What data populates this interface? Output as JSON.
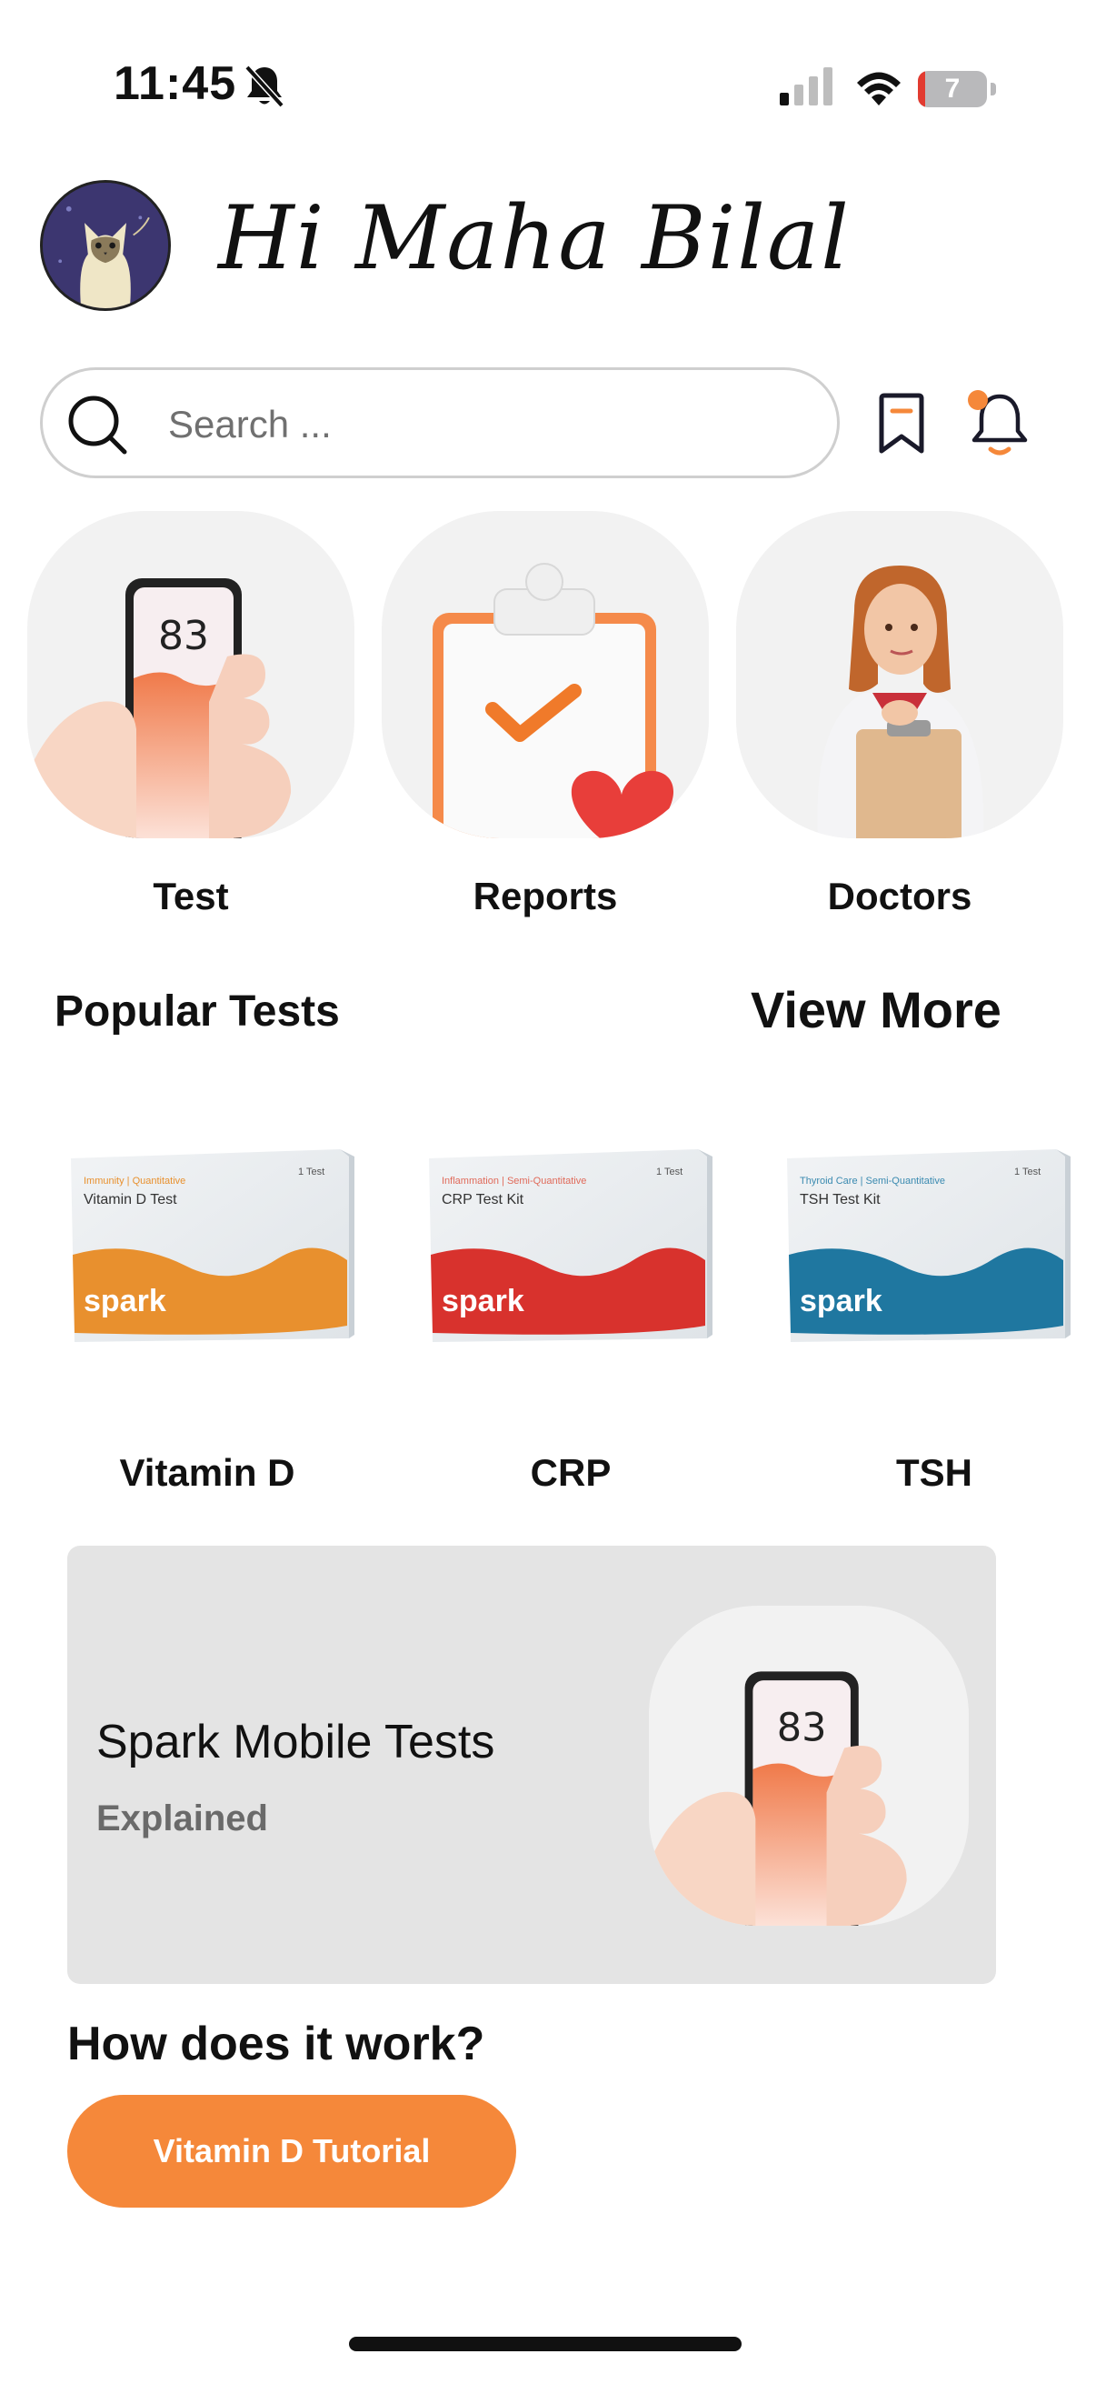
{
  "status_bar": {
    "time": "11:45",
    "battery_level": "7"
  },
  "header": {
    "greeting": "Hi  Maha Bilal"
  },
  "search": {
    "placeholder": "Search ..."
  },
  "categories": [
    {
      "label": "Test",
      "phone_reading": "83"
    },
    {
      "label": "Reports"
    },
    {
      "label": "Doctors"
    }
  ],
  "popular_tests": {
    "title": "Popular Tests",
    "view_more": "View More",
    "items": [
      {
        "name": "Vitamin D",
        "box_tag": "Immunity | Quantitative",
        "box_title": "Vitamin D Test",
        "box_count": "1 Test",
        "brand": "spark",
        "color": "#e8902e"
      },
      {
        "name": "CRP",
        "box_tag": "Inflammation | Semi-Quantitative",
        "box_title": "CRP Test Kit",
        "box_count": "1 Test",
        "brand": "spark",
        "color": "#d8322d"
      },
      {
        "name": "TSH",
        "box_tag": "Thyroid Care | Semi-Quantitative",
        "box_title": "TSH Test Kit",
        "box_count": "1 Test",
        "brand": "spark",
        "color": "#1f77a0"
      }
    ]
  },
  "banner": {
    "title": "Spark Mobile Tests",
    "subtitle": "Explained",
    "phone_reading": "83"
  },
  "how_it_works": {
    "title": "How does it work?",
    "button_label": "Vitamin D Tutorial"
  },
  "colors": {
    "accent": "#f5883a",
    "banner_bg": "#e4e4e4",
    "tile_bg": "#f2f2f2"
  }
}
